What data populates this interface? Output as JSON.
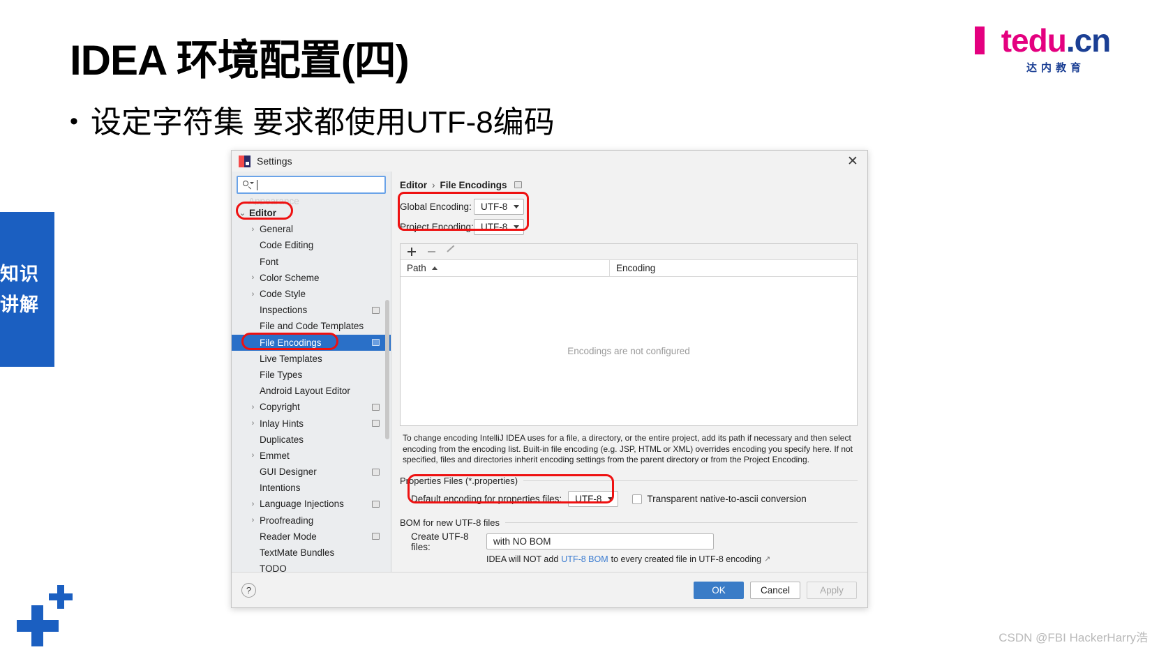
{
  "slide": {
    "title": "IDEA 环境配置(四)",
    "bullet_marker": "•",
    "bullet_text": "设定字符集  要求都使用UTF-8编码",
    "side_tab_text": "知识讲解",
    "watermark": "CSDN @FBI HackerHarry浩"
  },
  "logo": {
    "t": "t",
    "edu": "edu",
    "dot": ".",
    "cn": "cn",
    "sub": "达内教育"
  },
  "dialog": {
    "title": "Settings",
    "close_label": "✕",
    "search": {
      "value": "",
      "placeholder": ""
    },
    "breadcrumb": {
      "parent": "Editor",
      "separator": "›",
      "current": "File Encodings"
    },
    "nav": [
      {
        "label": "Editor",
        "level": 0,
        "arrow": "⌄",
        "selected": false,
        "badge": false
      },
      {
        "label": "General",
        "level": 1,
        "arrow": "›",
        "selected": false,
        "badge": false
      },
      {
        "label": "Code Editing",
        "level": 1,
        "arrow": "",
        "selected": false,
        "badge": false
      },
      {
        "label": "Font",
        "level": 1,
        "arrow": "",
        "selected": false,
        "badge": false
      },
      {
        "label": "Color Scheme",
        "level": 1,
        "arrow": "›",
        "selected": false,
        "badge": false
      },
      {
        "label": "Code Style",
        "level": 1,
        "arrow": "›",
        "selected": false,
        "badge": false
      },
      {
        "label": "Inspections",
        "level": 1,
        "arrow": "",
        "selected": false,
        "badge": true
      },
      {
        "label": "File and Code Templates",
        "level": 1,
        "arrow": "",
        "selected": false,
        "badge": false
      },
      {
        "label": "File Encodings",
        "level": 1,
        "arrow": "",
        "selected": true,
        "badge": true
      },
      {
        "label": "Live Templates",
        "level": 1,
        "arrow": "",
        "selected": false,
        "badge": false
      },
      {
        "label": "File Types",
        "level": 1,
        "arrow": "",
        "selected": false,
        "badge": false
      },
      {
        "label": "Android Layout Editor",
        "level": 1,
        "arrow": "",
        "selected": false,
        "badge": false
      },
      {
        "label": "Copyright",
        "level": 1,
        "arrow": "›",
        "selected": false,
        "badge": true
      },
      {
        "label": "Inlay Hints",
        "level": 1,
        "arrow": "›",
        "selected": false,
        "badge": true
      },
      {
        "label": "Duplicates",
        "level": 1,
        "arrow": "",
        "selected": false,
        "badge": false
      },
      {
        "label": "Emmet",
        "level": 1,
        "arrow": "›",
        "selected": false,
        "badge": false
      },
      {
        "label": "GUI Designer",
        "level": 1,
        "arrow": "",
        "selected": false,
        "badge": true
      },
      {
        "label": "Intentions",
        "level": 1,
        "arrow": "",
        "selected": false,
        "badge": false
      },
      {
        "label": "Language Injections",
        "level": 1,
        "arrow": "›",
        "selected": false,
        "badge": true
      },
      {
        "label": "Proofreading",
        "level": 1,
        "arrow": "›",
        "selected": false,
        "badge": false
      },
      {
        "label": "Reader Mode",
        "level": 1,
        "arrow": "",
        "selected": false,
        "badge": true
      },
      {
        "label": "TextMate Bundles",
        "level": 1,
        "arrow": "",
        "selected": false,
        "badge": false
      },
      {
        "label": "TODO",
        "level": 1,
        "arrow": "",
        "selected": false,
        "badge": false
      }
    ],
    "encodings": {
      "global_label": "Global Encoding:",
      "global_value": "UTF-8",
      "project_label": "Project Encoding:",
      "project_value": "UTF-8"
    },
    "table": {
      "toolbar": {
        "add": "+",
        "remove": "−",
        "edit": "✎"
      },
      "columns": [
        "Path",
        "Encoding"
      ],
      "sort_column": "Path",
      "sort_direction": "asc",
      "rows": [],
      "empty_message": "Encodings are not configured"
    },
    "description": "To change encoding IntelliJ IDEA uses for a file, a directory, or the entire project, add its path if necessary and then select encoding from the encoding list. Built-in file encoding (e.g. JSP, HTML or XML) overrides encoding you specify here. If not specified, files and directories inherit encoding settings from the parent directory or from the Project Encoding.",
    "properties_section": {
      "title": "Properties Files (*.properties)",
      "default_encoding_label": "Default encoding for properties files:",
      "default_encoding_value": "UTF-8",
      "transparent_label": "Transparent native-to-ascii conversion",
      "transparent_checked": false
    },
    "bom_section": {
      "title": "BOM for new UTF-8 files",
      "create_label": "Create UTF-8 files:",
      "create_value": "with NO BOM",
      "note_prefix": "IDEA will NOT add ",
      "note_link": "UTF-8 BOM",
      "note_suffix": " to every created file in UTF-8 encoding",
      "external_icon": "↗"
    },
    "footer": {
      "help": "?",
      "ok": "OK",
      "cancel": "Cancel",
      "apply": "Apply"
    }
  },
  "colors": {
    "selection_blue": "#2a70c8",
    "primary_button": "#3a7cc7",
    "annotation_red": "#ee1111",
    "link_blue": "#3a7bd0",
    "brand_pink": "#e4007f",
    "brand_navy": "#1b3f94",
    "side_tab_blue": "#1b5fc1"
  }
}
